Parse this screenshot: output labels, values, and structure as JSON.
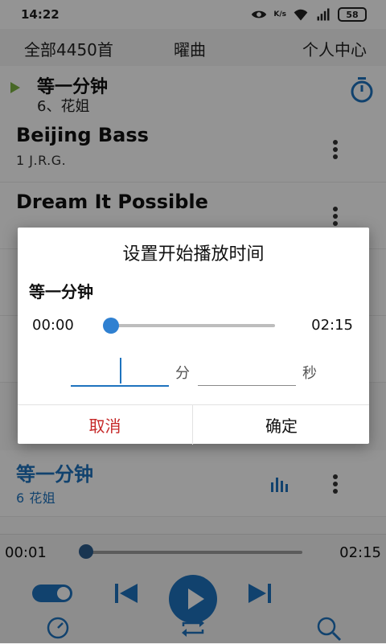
{
  "status_bar": {
    "time": "14:22",
    "battery": "58",
    "network_speed": "K/s",
    "icons": [
      "eye-icon",
      "data-speed-icon",
      "wifi-icon",
      "signal-icon",
      "battery-icon"
    ]
  },
  "nav": {
    "all_songs": "全部4450首",
    "curve": "曜曲",
    "profile": "个人中心"
  },
  "now_playing": {
    "title": "等一分钟",
    "subtitle": "6、花姐"
  },
  "songs": [
    {
      "title": "Beijing Bass",
      "subtitle": "1  J.R.G."
    },
    {
      "title": "Dream It Possible",
      "subtitle": ""
    },
    {
      "title": "等一分钟",
      "subtitle": "6  花姐"
    }
  ],
  "player": {
    "current_time": "00:01",
    "total_time": "02:15",
    "progress": 0.01,
    "loop_toggle_on": true
  },
  "dialog": {
    "title": "设置开始播放时间",
    "song": "等一分钟",
    "start_time": "00:00",
    "end_time": "02:15",
    "slider_value": 0,
    "minutes_label": "分",
    "seconds_label": "秒",
    "minutes_value": "",
    "seconds_value": "",
    "cancel": "取消",
    "confirm": "确定"
  },
  "colors": {
    "accent": "#1e73be",
    "cancel": "#c62828",
    "now_playing_marker": "#7cb342"
  }
}
